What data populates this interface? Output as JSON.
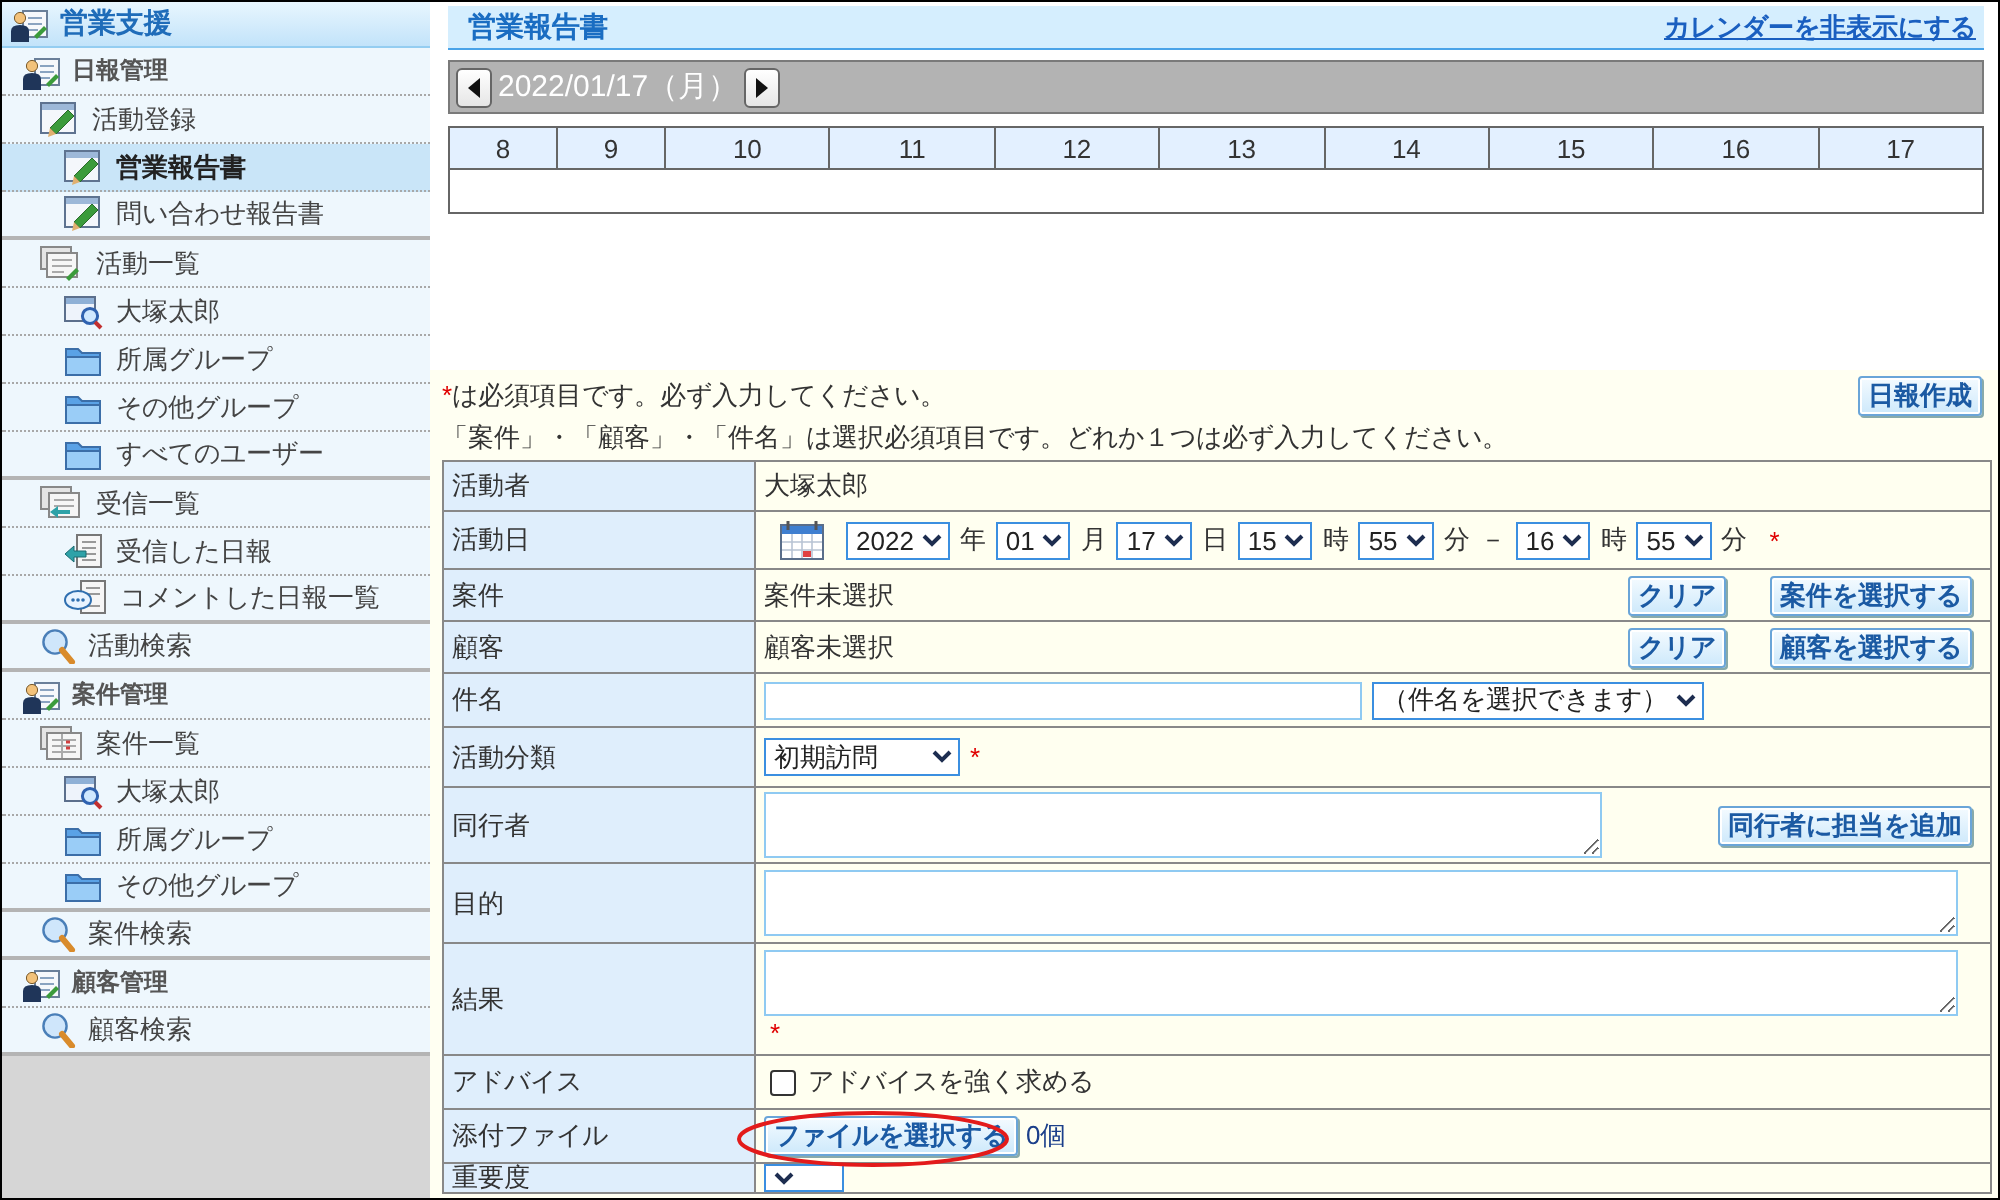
{
  "sidebar": {
    "title": "営業支援",
    "sections": [
      {
        "label": "日報管理",
        "children": [
          {
            "label": "活動登録",
            "kind": "form",
            "selected": false,
            "children": [
              {
                "label": "営業報告書",
                "kind": "form",
                "selected": true
              },
              {
                "label": "問い合わせ報告書",
                "kind": "form",
                "selected": false
              }
            ]
          },
          {
            "label": "活動一覧",
            "kind": "list",
            "selected": false,
            "children": [
              {
                "label": "大塚太郎",
                "kind": "person",
                "selected": false
              },
              {
                "label": "所属グループ",
                "kind": "folder",
                "selected": false
              },
              {
                "label": "その他グループ",
                "kind": "folder",
                "selected": false
              },
              {
                "label": "すべてのユーザー",
                "kind": "folder",
                "selected": false
              }
            ]
          },
          {
            "label": "受信一覧",
            "kind": "inbox",
            "selected": false,
            "children": [
              {
                "label": "受信した日報",
                "kind": "received",
                "selected": false
              },
              {
                "label": "コメントした日報一覧",
                "kind": "comment",
                "selected": false
              }
            ]
          },
          {
            "label": "活動検索",
            "kind": "search",
            "selected": false
          }
        ]
      },
      {
        "label": "案件管理",
        "children": [
          {
            "label": "案件一覧",
            "kind": "table",
            "selected": false,
            "children": [
              {
                "label": "大塚太郎",
                "kind": "person",
                "selected": false
              },
              {
                "label": "所属グループ",
                "kind": "folder",
                "selected": false
              },
              {
                "label": "その他グループ",
                "kind": "folder",
                "selected": false
              }
            ]
          },
          {
            "label": "案件検索",
            "kind": "search",
            "selected": false
          }
        ]
      },
      {
        "label": "顧客管理",
        "children": [
          {
            "label": "顧客検索",
            "kind": "search",
            "selected": false
          }
        ]
      }
    ]
  },
  "header": {
    "title": "営業報告書",
    "toggle_link": "カレンダーを非表示にする"
  },
  "calendar": {
    "date": "2022/01/17（月）",
    "hours": [
      "8",
      "9",
      "10",
      "11",
      "12",
      "13",
      "14",
      "15",
      "16",
      "17"
    ]
  },
  "notes": {
    "required_note": {
      "mark": "*",
      "text": "は必須項目です。必ず入力してください。"
    },
    "create_button": "日報作成",
    "selection_note": "「案件」・「顧客」・「件名」は選択必須項目です。どれか１つは必ず入力してください。"
  },
  "form": {
    "rows": [
      {
        "kind": "text",
        "label": "活動者",
        "value": "大塚太郎"
      },
      {
        "kind": "datetime",
        "label": "活動日",
        "start": [
          {
            "value": "2022",
            "unit": "年"
          },
          {
            "value": "01",
            "unit": "月"
          },
          {
            "value": "17",
            "unit": "日"
          },
          {
            "value": "15",
            "unit": "時"
          },
          {
            "value": "55",
            "unit": "分"
          }
        ],
        "separator": "－",
        "end": [
          {
            "value": "16",
            "unit": "時"
          },
          {
            "value": "55",
            "unit": "分"
          }
        ],
        "mark": "*"
      },
      {
        "kind": "picker",
        "label": "案件",
        "value": "案件未選択",
        "buttons": [
          "クリア",
          "案件を選択する"
        ]
      },
      {
        "kind": "picker",
        "label": "顧客",
        "value": "顧客未選択",
        "buttons": [
          "クリア",
          "顧客を選択する"
        ]
      },
      {
        "kind": "subject",
        "label": "件名",
        "select": "（件名を選択できます）"
      },
      {
        "kind": "select",
        "label": "活動分類",
        "value": "初期訪問",
        "mark": "*"
      },
      {
        "kind": "companions",
        "label": "同行者",
        "button": "同行者に担当を追加"
      },
      {
        "kind": "textarea",
        "label": "目的"
      },
      {
        "kind": "textarea",
        "label": "結果",
        "mark": "*"
      },
      {
        "kind": "checkbox",
        "label": "アドバイス",
        "option": "アドバイスを強く求める",
        "checked": false
      },
      {
        "kind": "file",
        "label": "添付ファイル",
        "button": "ファイルを選択する",
        "count": "0個",
        "highlighted": true
      },
      {
        "kind": "select",
        "label": "重要度"
      }
    ]
  }
}
